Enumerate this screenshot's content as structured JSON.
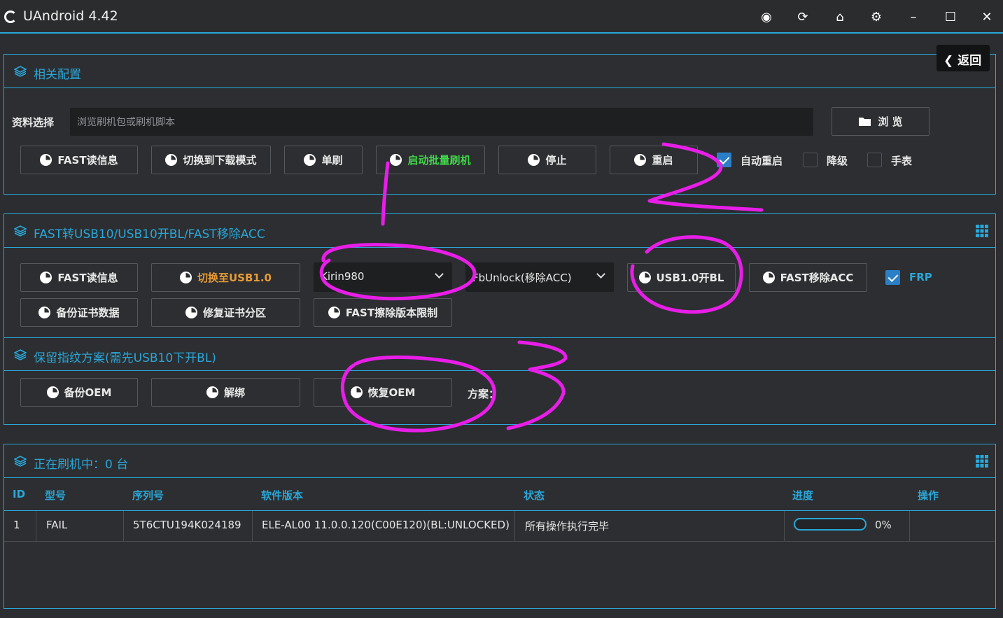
{
  "window": {
    "title": "UAndroid 4.42",
    "controls": [
      "globe-icon",
      "refresh-icon",
      "home-icon",
      "gear-icon",
      "minimize-icon",
      "maximize-icon",
      "close-icon"
    ]
  },
  "back_button": {
    "label": "返回"
  },
  "config": {
    "title": "相关配置",
    "file_label": "资料选择",
    "file_placeholder": "浏览刷机包或刷机脚本",
    "browse_label": "浏 览",
    "buttons": [
      "FAST读信息",
      "切换到下载模式",
      "单刷",
      "启动批量刷机",
      "停止",
      "重启"
    ],
    "checkboxes": [
      {
        "label": "自动重启",
        "checked": true
      },
      {
        "label": "降级",
        "checked": false
      },
      {
        "label": "手表",
        "checked": false
      }
    ]
  },
  "fast": {
    "title": "FAST转USB10/USB10开BL/FAST移除ACC",
    "buttons_row1": [
      "FAST读信息",
      "切换至USB1.0"
    ],
    "chip_select": "Kirin980",
    "unlock_select": "FbUnlock(移除ACC)",
    "buttons_row1_right": [
      "USB1.0开BL",
      "FAST移除ACC"
    ],
    "frp": {
      "label": "FRP",
      "checked": true
    },
    "buttons_row2": [
      "备份证书数据",
      "修复证书分区",
      "FAST擦除版本限制"
    ]
  },
  "fingerprint": {
    "title": "保留指纹方案(需先USB10下开BL)",
    "buttons": [
      "备份OEM",
      "解绑",
      "恢复OEM"
    ],
    "scheme_label": "方案："
  },
  "devices": {
    "title": "正在刷机中：0 台",
    "columns": [
      "ID",
      "型号",
      "序列号",
      "软件版本",
      "状态",
      "进度",
      "操作"
    ],
    "rows": [
      {
        "id": "1",
        "model": "FAIL",
        "serial": "5T6CTU194K024189",
        "version": "ELE-AL00 11.0.0.120(C00E120)(BL:UNLOCKED)",
        "status": "所有操作执行完毕",
        "progress": 0,
        "progress_text": "0%",
        "action": ""
      }
    ]
  },
  "colors": {
    "accent": "#2aa7d8",
    "annotation": "#e81ee8",
    "green": "#41d64a",
    "orange": "#e89b35"
  }
}
